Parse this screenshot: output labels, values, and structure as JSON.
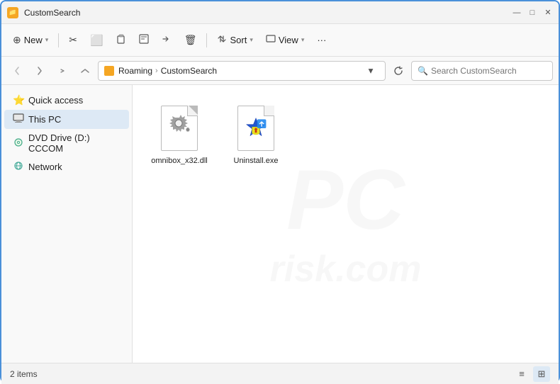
{
  "window": {
    "title": "CustomSearch",
    "icon": "📁"
  },
  "titlebar": {
    "minimize": "—",
    "maximize": "□",
    "close": "✕"
  },
  "toolbar": {
    "new_label": "New",
    "sort_label": "Sort",
    "view_label": "View",
    "more_label": "···",
    "new_icon": "⊕",
    "cut_icon": "✂",
    "copy_icon": "⬜",
    "paste_icon": "📋",
    "rename_icon": "[]",
    "share_icon": "↗",
    "delete_icon": "🗑",
    "sort_icon": "↕",
    "view_icon": "▭"
  },
  "addressbar": {
    "path_folder": "Roaming",
    "path_sep1": "›",
    "path_folder2": "CustomSearch",
    "search_placeholder": "Search CustomSearch"
  },
  "sidebar": {
    "items": [
      {
        "id": "quick-access",
        "label": "Quick access",
        "icon": "⭐",
        "active": false
      },
      {
        "id": "this-pc",
        "label": "This PC",
        "icon": "🖥",
        "active": true
      },
      {
        "id": "dvd-drive",
        "label": "DVD Drive (D:) CCCOM",
        "icon": "💿",
        "active": false
      },
      {
        "id": "network",
        "label": "Network",
        "icon": "🌐",
        "active": false
      }
    ]
  },
  "files": [
    {
      "id": "omnibox",
      "name": "omnibox_x32.dll",
      "type": "dll"
    },
    {
      "id": "uninstall",
      "name": "Uninstall.exe",
      "type": "exe"
    }
  ],
  "statusbar": {
    "count": "2 items",
    "view_list": "≡",
    "view_grid": "⊞"
  },
  "watermark": {
    "line1": "PC",
    "line2": "risk.com"
  }
}
